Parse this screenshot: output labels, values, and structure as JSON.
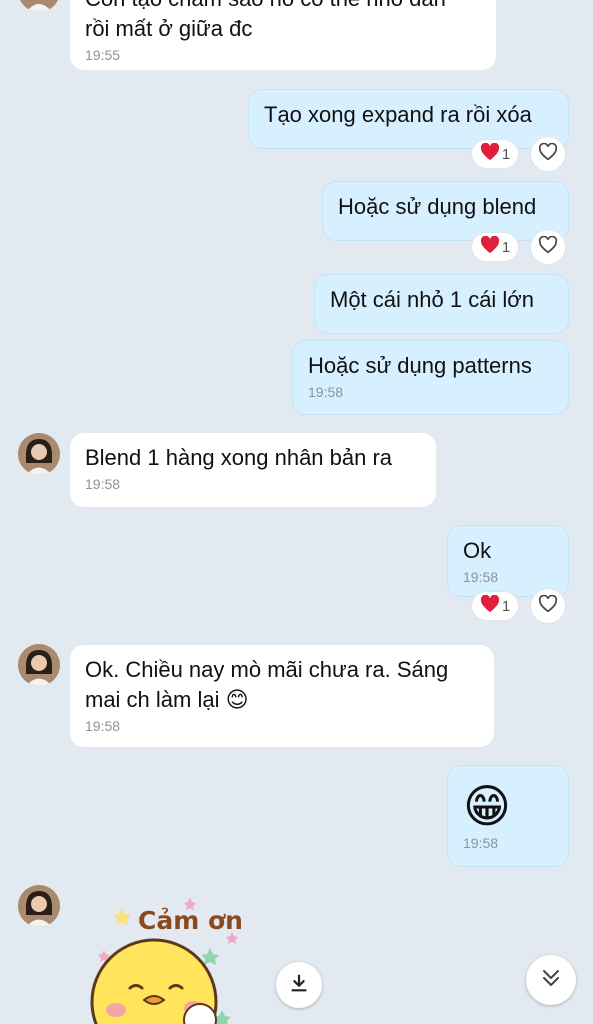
{
  "messages": {
    "m1": {
      "line1": "Còn tạo chấm sao nó có thể nhỏ dần",
      "line2": "rồi mất ở giữa đc",
      "time": "19:55"
    },
    "m2": {
      "text": "Tạo xong expand ra rồi xóa",
      "reaction_count": "1"
    },
    "m3": {
      "text": "Hoặc sử dụng blend",
      "reaction_count": "1"
    },
    "m4": {
      "text": "Một cái nhỏ 1 cái lớn"
    },
    "m5": {
      "text": "Hoặc sử dụng patterns",
      "time": "19:58"
    },
    "m6": {
      "text": "Blend 1 hàng xong nhân bản ra",
      "time": "19:58"
    },
    "m7": {
      "text": "Ok",
      "time": "19:58",
      "reaction_count": "1"
    },
    "m8": {
      "line1": "Ok. Chiều nay mò mãi chưa ra. Sáng",
      "line2": "mai ch làm lại 😊",
      "time": "19:58"
    },
    "m9": {
      "emoji": "😁",
      "time": "19:58"
    }
  },
  "sticker": {
    "caption": "Cảm ơn"
  },
  "icons": {
    "reaction": "heart-icon",
    "like": "heart-outline-icon",
    "download": "download-icon",
    "scroll_down": "double-chevron-down-icon"
  },
  "colors": {
    "background": "#e2e9f1",
    "incoming_bubble": "#ffffff",
    "outgoing_bubble": "#d7f0ff",
    "reaction_heart": "#e0203a"
  }
}
